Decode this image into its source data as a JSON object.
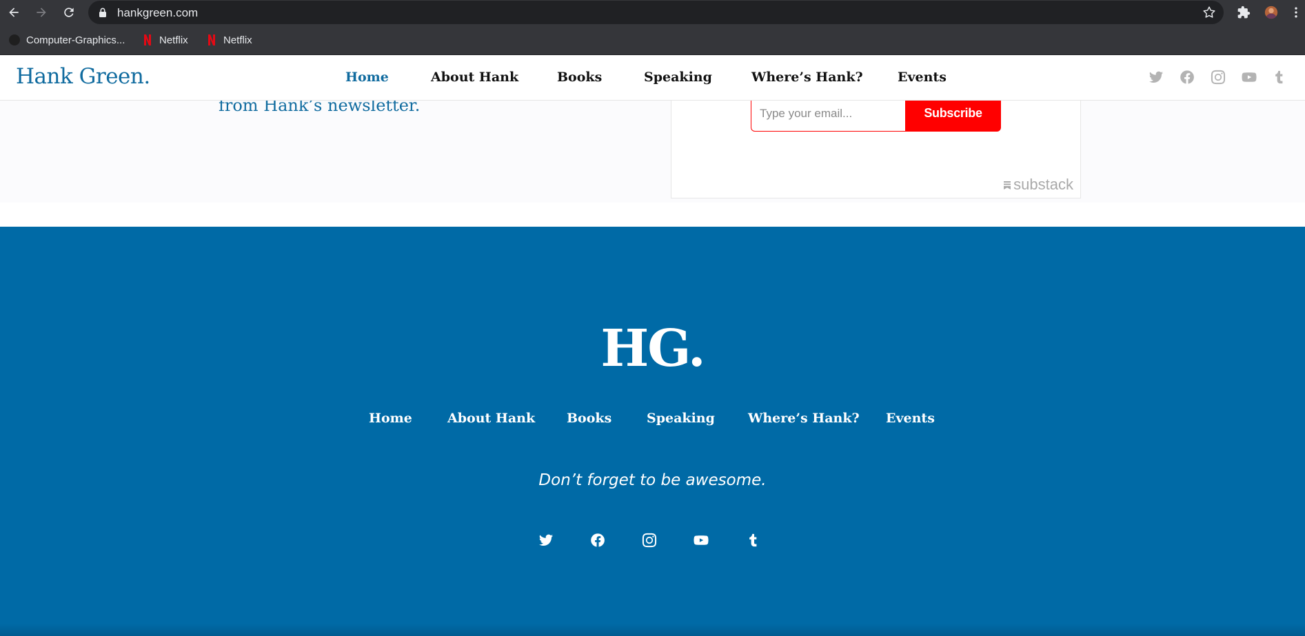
{
  "browser": {
    "url": "hankgreen.com",
    "bookmarks": [
      {
        "label": "Computer-Graphics..."
      },
      {
        "label": "Netflix"
      },
      {
        "label": "Netflix"
      }
    ]
  },
  "header": {
    "logo": "Hank Green.",
    "nav": [
      {
        "label": "Home",
        "active": true
      },
      {
        "label": "About Hank"
      },
      {
        "label": "Books"
      },
      {
        "label": "Speaking"
      },
      {
        "label": "Where’s Hank?"
      },
      {
        "label": "Events"
      }
    ],
    "social_icons": [
      "twitter-icon",
      "facebook-icon",
      "instagram-icon",
      "youtube-icon",
      "tumblr-icon"
    ]
  },
  "newsletter": {
    "text": "from Hank’s newsletter.",
    "email_placeholder": "Type your email...",
    "subscribe_label": "Subscribe",
    "badge": "substack"
  },
  "footer": {
    "logo": "HG.",
    "nav": [
      {
        "label": "Home"
      },
      {
        "label": "About Hank"
      },
      {
        "label": "Books"
      },
      {
        "label": "Speaking"
      },
      {
        "label": "Where’s Hank?"
      },
      {
        "label": "Events"
      }
    ],
    "tagline": "Don’t forget to be awesome.",
    "social_icons": [
      "twitter-icon",
      "facebook-icon",
      "instagram-icon",
      "youtube-icon",
      "tumblr-icon"
    ]
  },
  "colors": {
    "brand_blue": "#106b9f",
    "footer_blue": "#006aa6",
    "subscribe_red": "#ff0000"
  }
}
